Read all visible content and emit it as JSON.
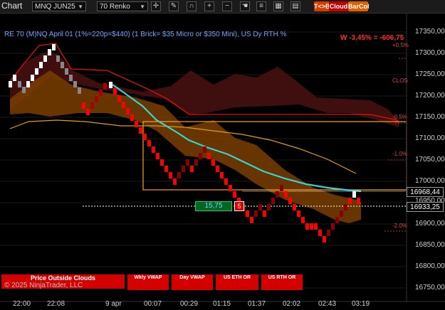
{
  "toolbar": {
    "title": "Chart",
    "instrument": "MNQ JUN25",
    "bar_type": "70 Renko",
    "buttons": [
      {
        "label": "T<>B",
        "color": "#d63b00"
      },
      {
        "label": "Cloud",
        "color": "#c00000"
      },
      {
        "label": "BarCol",
        "color": "#e06000"
      }
    ],
    "icons": [
      "crosshair-icon",
      "pencil-icon",
      "magnet-icon",
      "zoom-in-icon",
      "zoom-out-icon",
      "hand-icon",
      "lines-icon",
      "grid-icon",
      "properties-icon"
    ]
  },
  "chart": {
    "caption": "RE 70 (M)NQ April 01 (1%=220p=$440) (1 Brick= $35 Micro or $350 Mini), US Dy RTH %",
    "pnl": "W -3,45% = -606,75",
    "close_label": "CLOS",
    "price_axis": [
      "17350,00",
      "17300,00",
      "17250,00",
      "17200,00",
      "17150,00",
      "17100,00",
      "17050,00",
      "17000,00",
      "16950,00",
      "16900,00",
      "16850,00",
      "16800,00",
      "16750,00"
    ],
    "price_labels": {
      "current": "16968,44",
      "last": "16933,25"
    },
    "percent_labels": [
      "+0.5%",
      "-0.5%",
      "-1.0%",
      "-2.0%"
    ],
    "range_box": "15,75",
    "small_box": "5",
    "time_axis": [
      "22:00",
      "22:08",
      "9 apr",
      "00:07",
      "00:29",
      "01:15",
      "01:37",
      "02:02",
      "02:43",
      "03:19"
    ],
    "copyright": "© 2025 NinjaTrader, LLC",
    "bottom_buttons": [
      {
        "label": "Price Outside Clouds",
        "wide": true
      },
      {
        "label": "Wkly VWAP"
      },
      {
        "label": "Day VWAP"
      },
      {
        "label": "US ETH OR"
      },
      {
        "label": "US RTH OR"
      }
    ]
  },
  "colors": {
    "up_brick": "#ffffff",
    "down_brick": "#ff0000",
    "cloud_upper": "#6b1a1a",
    "cloud_lower": "#7a3d00",
    "vwap": "#36d3d3",
    "orange_line": "#e0a000"
  }
}
